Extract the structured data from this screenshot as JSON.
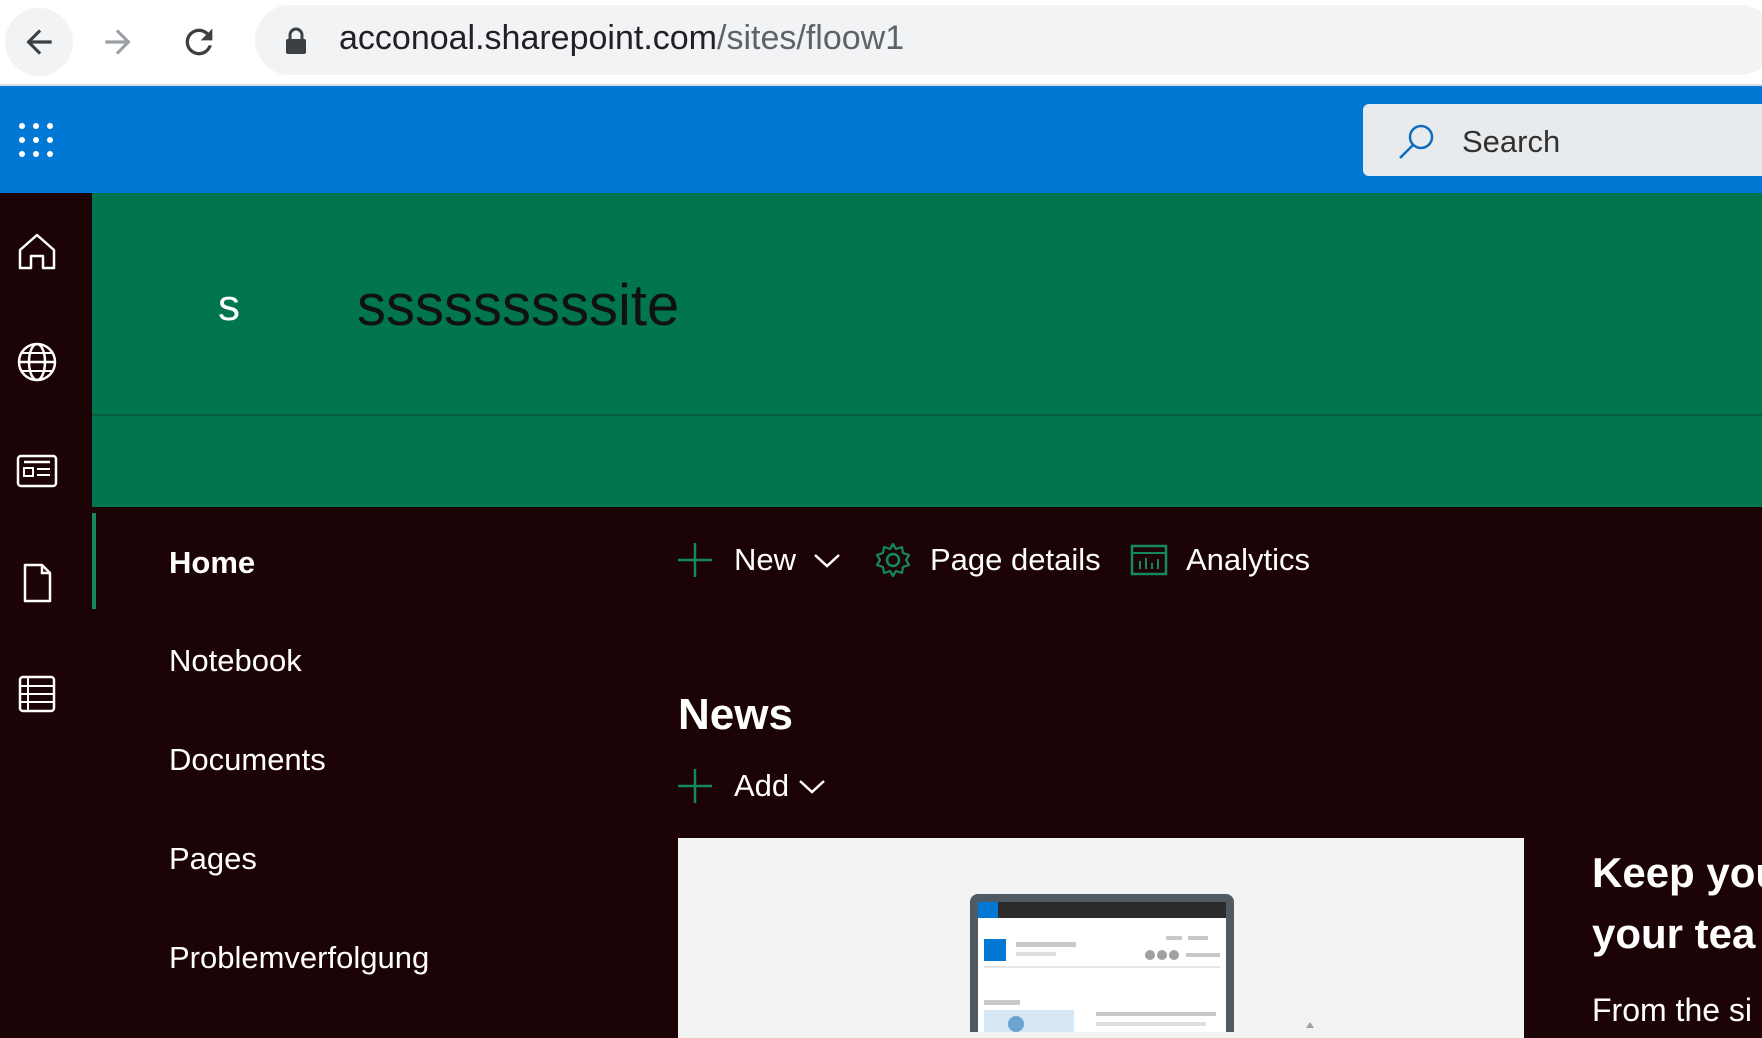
{
  "browser": {
    "url_host": "acconoal.sharepoint.com",
    "url_path": "/sites/floow1"
  },
  "suite_bar": {
    "search_placeholder": "Search"
  },
  "site": {
    "logo_letter": "s",
    "name": "sssssssssite"
  },
  "left_nav": {
    "items": [
      {
        "label": "Home",
        "selected": true
      },
      {
        "label": "Notebook"
      },
      {
        "label": "Documents"
      },
      {
        "label": "Pages"
      },
      {
        "label": "Problemverfolgung"
      }
    ]
  },
  "command_bar": {
    "new_label": "New",
    "page_details_label": "Page details",
    "analytics_label": "Analytics"
  },
  "news": {
    "title": "News",
    "add_label": "Add",
    "promo_title_line1": "Keep you",
    "promo_title_line2": "your tea",
    "promo_text": "From the si"
  },
  "colors": {
    "suite_bar": "#0078d4",
    "header": "#00754f",
    "background": "#1c0305",
    "accent_green": "#138a5c"
  }
}
